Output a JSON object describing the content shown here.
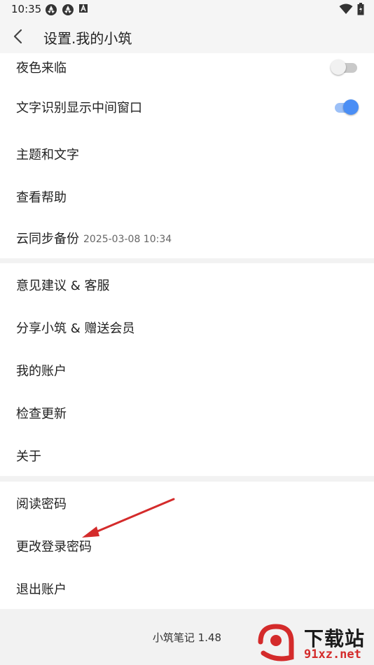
{
  "status_bar": {
    "time": "10:35",
    "icons": [
      "aperture-icon",
      "aperture-icon",
      "a-badge-icon",
      "wifi-icon",
      "battery-icon"
    ]
  },
  "app_bar": {
    "title": "设置.我的小筑"
  },
  "section1": {
    "items": [
      {
        "label": "夜色来临",
        "toggle": "off"
      },
      {
        "label": "文字识别显示中间窗口",
        "toggle": "on"
      },
      {
        "label": "主题和文字"
      },
      {
        "label": "查看帮助"
      },
      {
        "label": "云同步备份",
        "sub": "2025-03-08 10:34"
      }
    ]
  },
  "section2": {
    "items": [
      {
        "label": "意见建议 & 客服"
      },
      {
        "label": "分享小筑 & 赠送会员"
      },
      {
        "label": "我的账户"
      },
      {
        "label": "检查更新"
      },
      {
        "label": "关于"
      }
    ]
  },
  "section3": {
    "items": [
      {
        "label": "阅读密码"
      },
      {
        "label": "更改登录密码"
      },
      {
        "label": "退出账户"
      }
    ]
  },
  "footer": {
    "version": "小筑笔记 1.48"
  },
  "watermark": {
    "title": "下载站",
    "url": "91xz.net"
  },
  "colors": {
    "accent": "#4a8ef5",
    "arrow": "#d42b2b",
    "background": "#f2f2f2"
  }
}
